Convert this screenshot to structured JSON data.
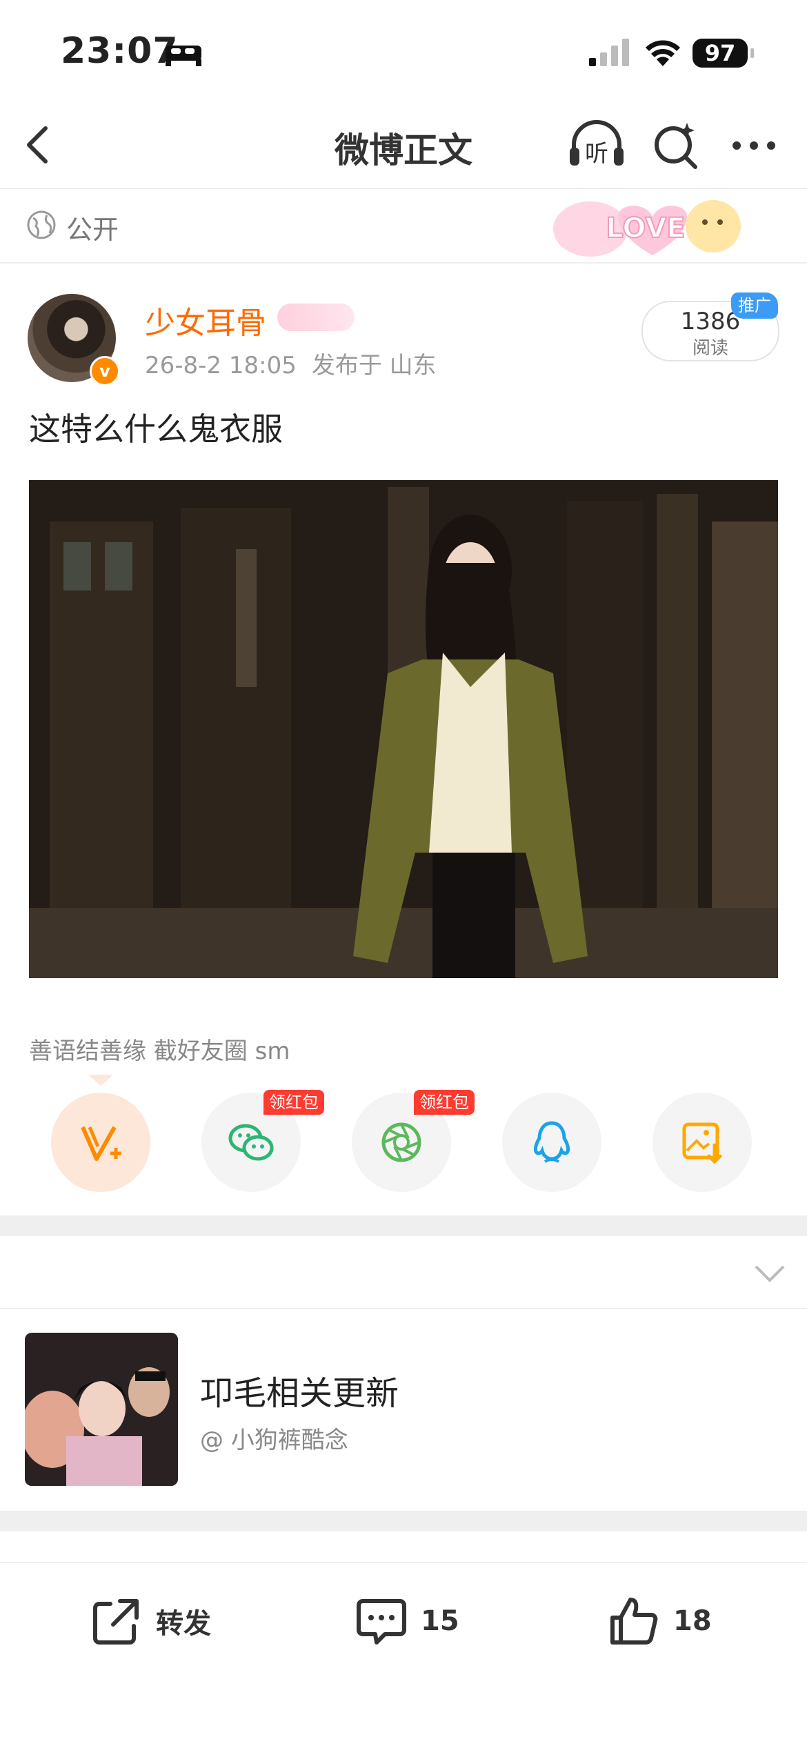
{
  "status_bar": {
    "time": "23:07",
    "battery": "97"
  },
  "nav": {
    "title": "微博正文",
    "listen_label": "听"
  },
  "visibility": {
    "label": "公开",
    "sticker_text": "LOVE"
  },
  "post": {
    "username": "少女耳骨",
    "date": "26-8-2 18:05",
    "location": "发布于 山东",
    "reads": "1386",
    "reads_label": "阅读",
    "promo": "推广",
    "text": "这特么什么鬼衣服"
  },
  "share": {
    "text": "善语结善缘 截好友圈 sm",
    "red_packet_label": "领红包",
    "buttons": [
      "vplus-icon",
      "wechat-icon",
      "moments-icon",
      "qq-icon",
      "save-image-icon"
    ]
  },
  "related": {
    "title": "卭毛相关更新",
    "subtitle": "@ 小狗裤酷念"
  },
  "toolbar": {
    "repost_label": "转发",
    "comments_count": "15",
    "likes_count": "18"
  },
  "colors": {
    "accent": "#ff6a00",
    "promo": "#3b9bf5",
    "red_packet": "#ff3b30"
  }
}
